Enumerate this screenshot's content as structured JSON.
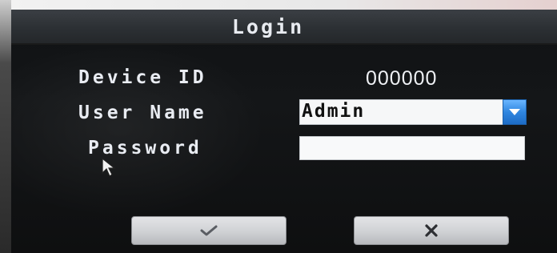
{
  "dialog": {
    "title": "Login",
    "device_id": {
      "label": "Device ID",
      "value": "000000"
    },
    "user_name": {
      "label": "User Name",
      "selected": "Admin"
    },
    "password": {
      "label": "Password",
      "value": ""
    },
    "ok_icon": "check-icon",
    "cancel_icon": "close-icon"
  },
  "colors": {
    "title_bar": "#2c3034",
    "dropdown_accent": "#2f86e0",
    "button_face": "#cfd1d4"
  }
}
